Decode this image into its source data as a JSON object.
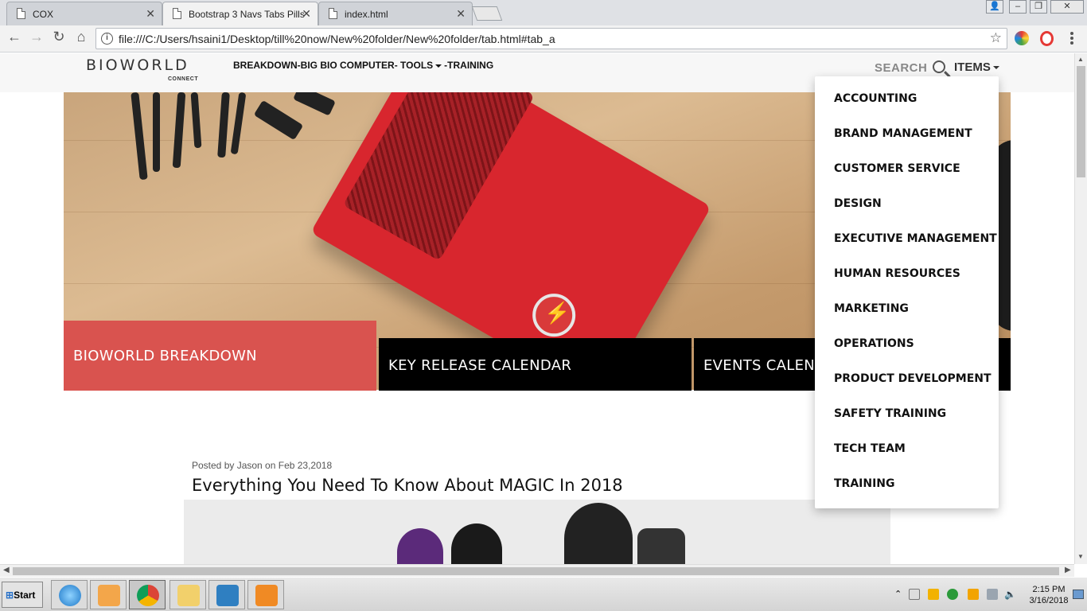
{
  "browser": {
    "tabs": [
      {
        "title": "COX",
        "close": "✕"
      },
      {
        "title": "Bootstrap 3 Navs Tabs Pills",
        "close": "✕"
      },
      {
        "title": "index.html",
        "close": "✕"
      }
    ],
    "url": "file:///C:/Users/hsaini1/Desktop/till%20now/New%20folder/New%20folder/tab.html#tab_a",
    "icons": [
      "back-icon",
      "forward-icon",
      "reload-icon",
      "home-icon",
      "info-icon",
      "star-icon",
      "menu-icon"
    ]
  },
  "site": {
    "logo": {
      "word": "BIOWORLD",
      "sub": "CONNECT"
    },
    "nav": {
      "breakdown": "BREAKDOWN",
      "sep1": "-",
      "big_bio": "BIG BIO COMPUTER",
      "sep2": "-",
      "tools": "TOOLS",
      "sep3": "-",
      "training": "TRAINING"
    },
    "search_label": "SEARCH",
    "items_label": "ITEMS",
    "dropdown": [
      "ACCOUNTING",
      "BRAND MANAGEMENT",
      "CUSTOMER SERVICE",
      "DESIGN",
      "EXECUTIVE MANAGEMENT",
      "HUMAN RESOURCES",
      "MARKETING",
      "OPERATIONS",
      "PRODUCT DEVELOPMENT",
      "SAFETY TRAINING",
      "TECH TEAM",
      "TRAINING"
    ],
    "features": [
      "BIOWORLD BREAKDOWN",
      "KEY RELEASE CALENDAR",
      "EVENTS CALENDAR"
    ],
    "post": {
      "meta": "Posted by Jason on Feb 23,2018",
      "title": "Everything You Need To Know About MAGIC In 2018"
    }
  },
  "taskbar": {
    "start": "Start",
    "time": "2:15 PM",
    "date": "3/16/2018"
  },
  "colors": {
    "feature_highlight": "#d9534f",
    "feature_dark": "#000000",
    "nav_bg": "#f7f7f7"
  }
}
